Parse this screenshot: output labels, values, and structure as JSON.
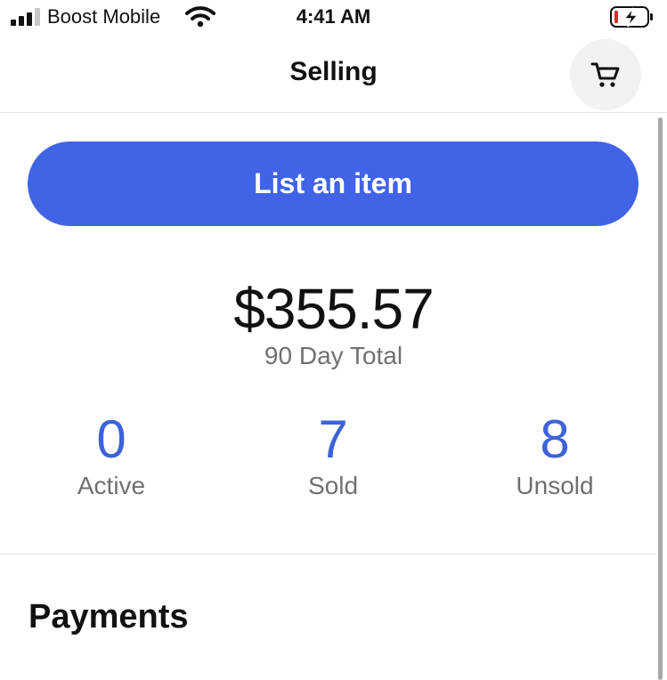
{
  "status_bar": {
    "carrier": "Boost Mobile",
    "time": "4:41 AM",
    "signal_icon": "signal-bars-icon",
    "wifi_icon": "wifi-icon",
    "battery_icon": "battery-charging-icon"
  },
  "header": {
    "title": "Selling",
    "cart_icon": "cart-icon"
  },
  "list_button": {
    "label": "List an item",
    "color": "#4163e6"
  },
  "summary": {
    "total": "$355.57",
    "total_label": "90 Day Total"
  },
  "stats": [
    {
      "value": "0",
      "label": "Active"
    },
    {
      "value": "7",
      "label": "Sold"
    },
    {
      "value": "8",
      "label": "Unsold"
    }
  ],
  "sections": {
    "payments_title": "Payments"
  },
  "colors": {
    "accent": "#3d63d8",
    "muted_text": "#707070"
  }
}
